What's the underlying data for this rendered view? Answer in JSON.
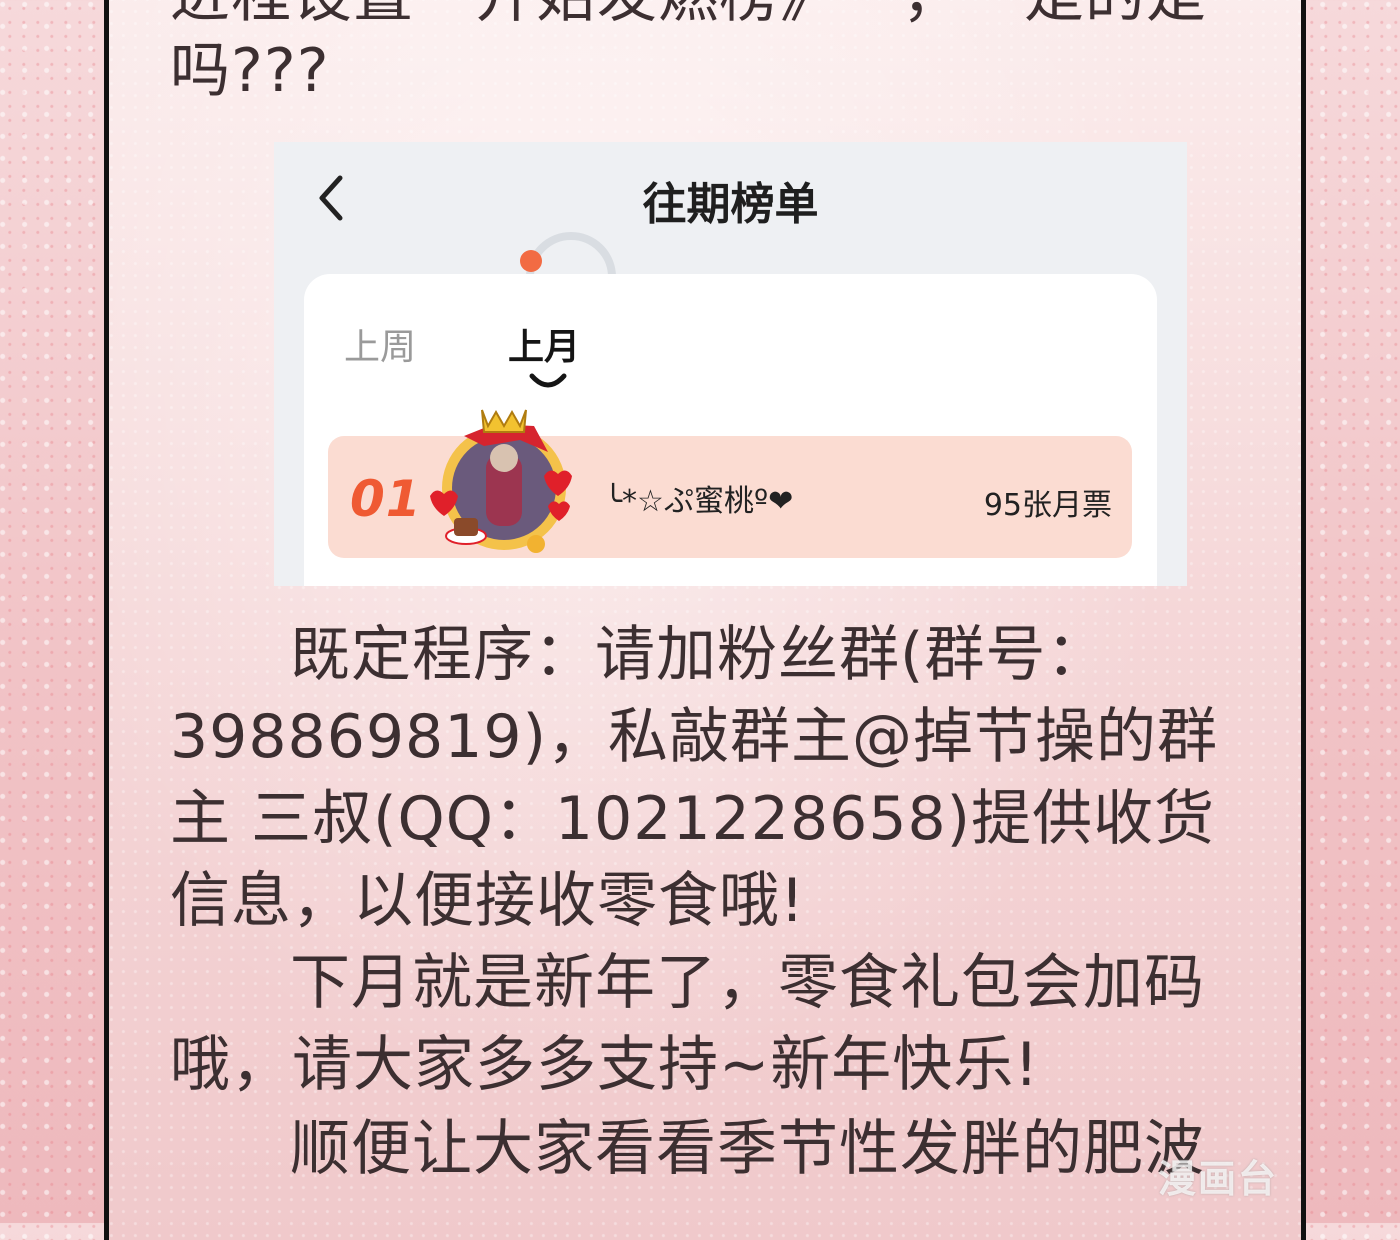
{
  "top_text_cut": "进程设置一开始发燃榜》一，一是的是",
  "top_text_end": "吗???",
  "app": {
    "title": "往期榜单",
    "tabs": [
      {
        "label": "上周",
        "active": false
      },
      {
        "label": "上月",
        "active": true
      }
    ],
    "ranking": [
      {
        "rank": "01",
        "name": "╰*☆ぷ蜜桃º❤",
        "votes": "95张月票"
      }
    ],
    "accent_color": "#ef5a33"
  },
  "paragraphs": [
    "既定程序：请加粉丝群(群号：398869819)，私敲群主@掉节操的群主 三叔(QQ：1021228658)提供收货信息，以便接收零食哦!",
    "下月就是新年了，零食礼包会加码哦，请大家多多支持~新年快乐!",
    "顺便让大家看看季节性发胖的肥波"
  ],
  "watermark": "漫画台"
}
